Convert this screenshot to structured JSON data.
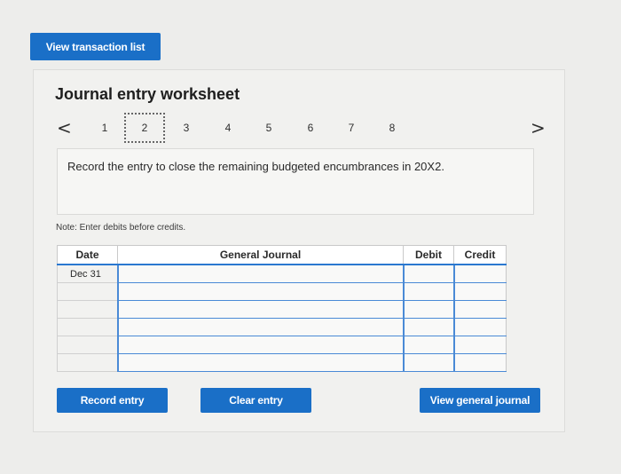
{
  "top_button": {
    "label": "View transaction list"
  },
  "worksheet": {
    "title": "Journal entry worksheet",
    "pager": {
      "prev_arrow": "<",
      "next_arrow": ">",
      "pages": [
        "1",
        "2",
        "3",
        "4",
        "5",
        "6",
        "7",
        "8"
      ],
      "active_page": "2"
    },
    "instruction": "Record the entry to close the remaining budgeted encumbrances in 20X2.",
    "note": "Note: Enter debits before credits.",
    "table": {
      "headers": {
        "date": "Date",
        "account": "General Journal",
        "debit": "Debit",
        "credit": "Credit"
      },
      "rows": [
        {
          "date": "Dec 31",
          "account": "",
          "debit": "",
          "credit": ""
        },
        {
          "date": "",
          "account": "",
          "debit": "",
          "credit": ""
        },
        {
          "date": "",
          "account": "",
          "debit": "",
          "credit": ""
        },
        {
          "date": "",
          "account": "",
          "debit": "",
          "credit": ""
        },
        {
          "date": "",
          "account": "",
          "debit": "",
          "credit": ""
        },
        {
          "date": "",
          "account": "",
          "debit": "",
          "credit": ""
        }
      ]
    },
    "buttons": {
      "record": "Record entry",
      "clear": "Clear entry",
      "view_general_journal": "View general journal"
    }
  },
  "colors": {
    "button_blue": "#1a6fc7",
    "input_border_blue": "#4a8ad6"
  }
}
